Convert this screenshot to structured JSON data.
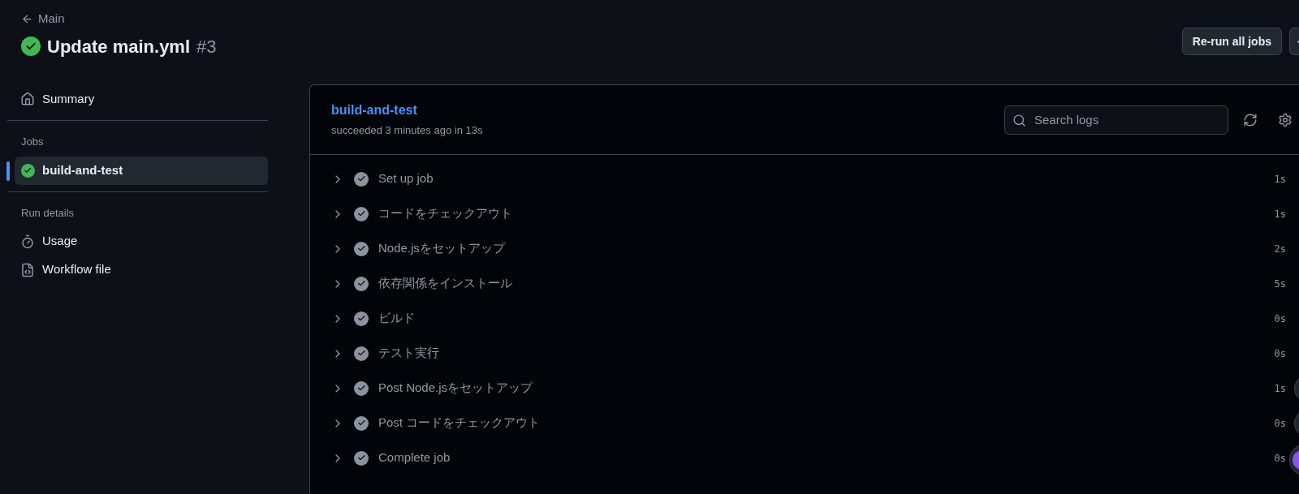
{
  "back_link": "Main",
  "run": {
    "title": "Update main.yml",
    "number": "#3"
  },
  "actions": {
    "rerun": "Re-run all jobs"
  },
  "sidebar": {
    "items": [
      {
        "kind": "summary",
        "label": "Summary",
        "selected": false
      }
    ],
    "jobs_heading": "Jobs",
    "jobs": [
      {
        "label": "build-and-test",
        "selected": true
      }
    ],
    "details_heading": "Run details",
    "details": [
      {
        "kind": "usage",
        "label": "Usage"
      },
      {
        "kind": "workflow",
        "label": "Workflow file"
      }
    ]
  },
  "job": {
    "name": "build-and-test",
    "summary": "succeeded 3 minutes ago in 13s",
    "search": {
      "placeholder": "Search logs"
    },
    "steps": [
      {
        "label": "Set up job",
        "duration": "1s",
        "expanded": false
      },
      {
        "label": "コードをチェックアウト",
        "duration": "1s",
        "expanded": false
      },
      {
        "label": "Node.jsをセットアップ",
        "duration": "2s",
        "expanded": false
      },
      {
        "label": "依存関係をインストール",
        "duration": "5s",
        "expanded": false
      },
      {
        "label": "ビルド",
        "duration": "0s",
        "expanded": false
      },
      {
        "label": "テスト実行",
        "duration": "0s",
        "expanded": false
      },
      {
        "label": "Post Node.jsをセットアップ",
        "duration": "1s",
        "expanded": false
      },
      {
        "label": "Post コードをチェックアウト",
        "duration": "0s",
        "expanded": false
      },
      {
        "label": "Complete job",
        "duration": "0s",
        "expanded": false
      }
    ]
  }
}
